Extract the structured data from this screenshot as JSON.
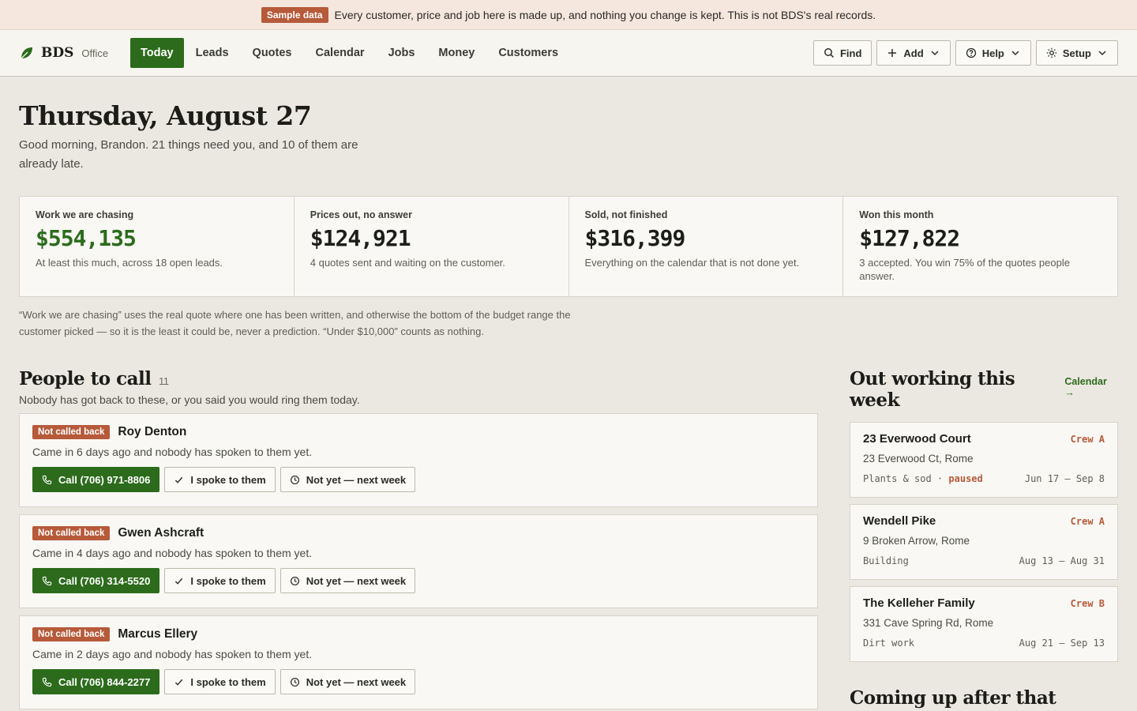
{
  "banner": {
    "tag": "Sample data",
    "text": "Every customer, price and job here is made up, and nothing you change is kept. This is not BDS's real records."
  },
  "nav": {
    "brand": "BDS",
    "brand_sub": "Office",
    "links": [
      "Today",
      "Leads",
      "Quotes",
      "Calendar",
      "Jobs",
      "Money",
      "Customers"
    ],
    "active": "Today",
    "tools": {
      "find": "Find",
      "add": "Add",
      "help": "Help",
      "setup": "Setup"
    }
  },
  "page": {
    "title": "Thursday, August 27",
    "greeting": "Good morning, Brandon. 21 things need you, and 10 of them are already late."
  },
  "stats": [
    {
      "label": "Work we are chasing",
      "value": "$554,135",
      "desc": "At least this much, across 18 open leads."
    },
    {
      "label": "Prices out, no answer",
      "value": "$124,921",
      "desc": "4 quotes sent and waiting on the customer."
    },
    {
      "label": "Sold, not finished",
      "value": "$316,399",
      "desc": "Everything on the calendar that is not done yet."
    },
    {
      "label": "Won this month",
      "value": "$127,822",
      "desc": "3 accepted. You win 75% of the quotes people answer."
    }
  ],
  "footnote": "“Work we are chasing” uses the real quote where one has been written, and otherwise the bottom of the budget range the customer picked — so it is the least it could be, never a prediction. “Under $10,000” counts as nothing.",
  "people": {
    "title": "People to call",
    "count": "11",
    "subtitle": "Nobody has got back to these, or you said you would ring them today.",
    "spoke_label": "I spoke to them",
    "later_label": "Not yet — next week",
    "items": [
      {
        "badge": "Not called back",
        "name": "Roy Denton",
        "line": "Came in 6 days ago and nobody has spoken to them yet.",
        "call": "Call (706) 971-8806"
      },
      {
        "badge": "Not called back",
        "name": "Gwen Ashcraft",
        "line": "Came in 4 days ago and nobody has spoken to them yet.",
        "call": "Call (706) 314-5520"
      },
      {
        "badge": "Not called back",
        "name": "Marcus Ellery",
        "line": "Came in 2 days ago and nobody has spoken to them yet.",
        "call": "Call (706) 844-2277"
      }
    ]
  },
  "working": {
    "title": "Out working this week",
    "link": "Calendar →",
    "jobs": [
      {
        "name": "23 Everwood Court",
        "crew": "Crew A",
        "addr": "23 Everwood Ct, Rome",
        "kind": "Plants & sod",
        "status": "paused",
        "dates": "Jun 17 – Sep 8"
      },
      {
        "name": "Wendell Pike",
        "crew": "Crew A",
        "addr": "9 Broken Arrow, Rome",
        "kind": "Building",
        "status": "",
        "dates": "Aug 13 – Aug 31"
      },
      {
        "name": "The Kelleher Family",
        "crew": "Crew B",
        "addr": "331 Cave Spring Rd, Rome",
        "kind": "Dirt work",
        "status": "",
        "dates": "Aug 21 – Sep 13"
      }
    ]
  },
  "after": {
    "title": "Coming up after that"
  },
  "colors": {
    "brand_green": "#2c6b1c",
    "alert_rust": "#b65a3a",
    "background": "#ebe8e1"
  }
}
